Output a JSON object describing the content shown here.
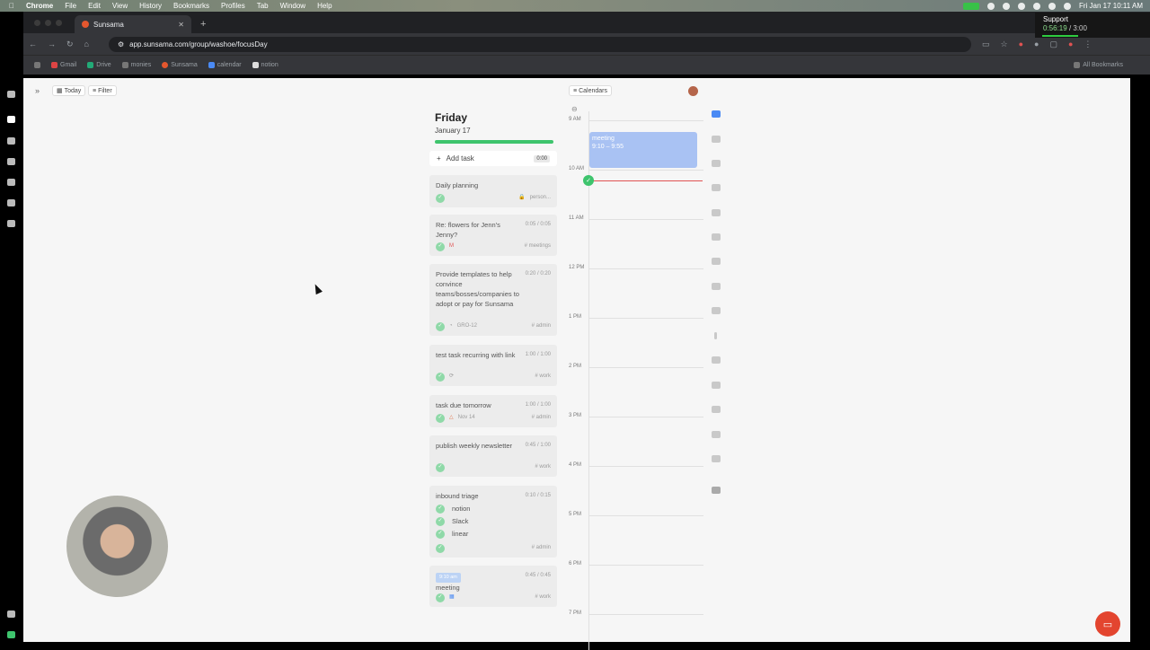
{
  "menubar": {
    "apple": "",
    "items": [
      "Chrome",
      "File",
      "Edit",
      "View",
      "History",
      "Bookmarks",
      "Profiles",
      "Tab",
      "Window",
      "Help"
    ],
    "clock": "Fri Jan 17  10:11 AM"
  },
  "support": {
    "title": "Support",
    "elapsed": "0:56:19",
    "total": "/ 3:00"
  },
  "browser": {
    "tab_title": "Sunsama",
    "url": "app.sunsama.com/group/washoe/focusDay",
    "bookmarks": [
      "Gmail",
      "Drive",
      "monies",
      "Sunsama",
      "calendar",
      "notion"
    ],
    "all_bookmarks": "All Bookmarks"
  },
  "toolbar": {
    "today": "Today",
    "filter": "Filter",
    "calendars": "Calendars"
  },
  "day": {
    "weekday": "Friday",
    "date": "January 17",
    "progress": 1.0
  },
  "add_task": {
    "label": "Add task",
    "time": "0:00"
  },
  "tasks": [
    {
      "title": "Daily planning",
      "time": "",
      "tag": "person..."
    },
    {
      "title": "Re: flowers for Jenn's Jenny?",
      "time": "0:05 / 0:05",
      "tag": "# meetings"
    },
    {
      "title": "Provide templates to help convince teams/bosses/companies to adopt or pay for Sunsama",
      "time": "0:20 / 0:20",
      "ref": "GRO-12",
      "tag": "# admin"
    },
    {
      "title": "test task recurring with link",
      "time": "1:00 / 1:00",
      "tag": "# work"
    },
    {
      "title": "task due tomorrow",
      "time": "1:00 / 1:00",
      "ref": "Nov 14",
      "tag": "# admin"
    },
    {
      "title": "publish weekly newsletter",
      "time": "0:45 / 1:00",
      "tag": "# work"
    },
    {
      "title": "inbound triage",
      "time": "0:10 / 0:15",
      "subtasks": [
        "notion",
        "Slack",
        "linear"
      ],
      "tag": "# admin"
    },
    {
      "title": "meeting",
      "time": "0:45 / 0:45",
      "badge": "9:10 am",
      "tag": "# work"
    }
  ],
  "calendar": {
    "hours": [
      "9 AM",
      "10 AM",
      "11 AM",
      "12 PM",
      "1 PM",
      "2 PM",
      "3 PM",
      "4 PM",
      "5 PM",
      "6 PM",
      "7 PM"
    ],
    "event": {
      "title": "meeting",
      "time": "9:10 – 9:55"
    }
  }
}
